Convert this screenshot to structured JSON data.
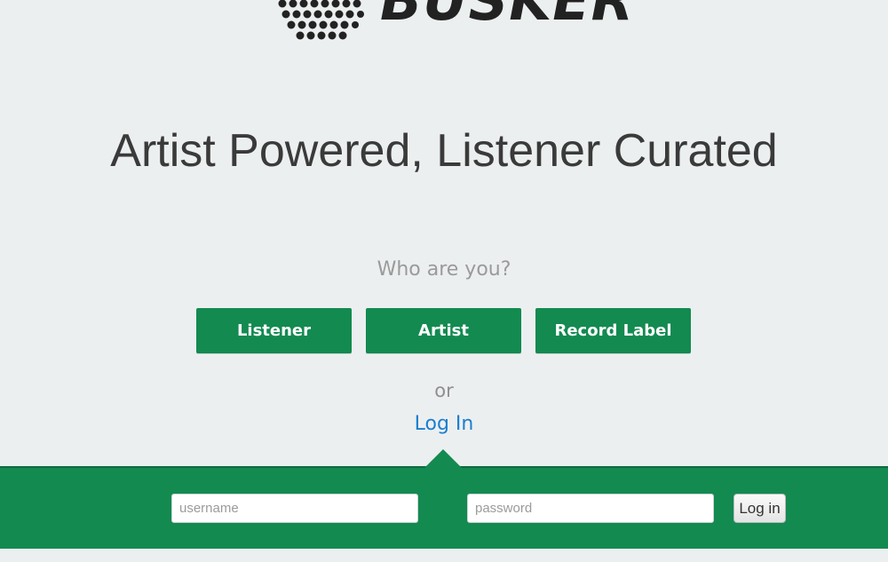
{
  "brand": {
    "logo_name": "busker-logo-icon",
    "wordmark": "BUSKER",
    "accent_color": "#138a50",
    "link_color": "#1a7fcf"
  },
  "hero": {
    "tagline": "Artist Powered, Listener Curated"
  },
  "roles": {
    "prompt": "Who are you?",
    "buttons": [
      "Listener",
      "Artist",
      "Record Label"
    ]
  },
  "login": {
    "separator": "or",
    "link_label": "Log In",
    "username_placeholder": "username",
    "password_placeholder": "password",
    "submit_label": "Log in"
  }
}
